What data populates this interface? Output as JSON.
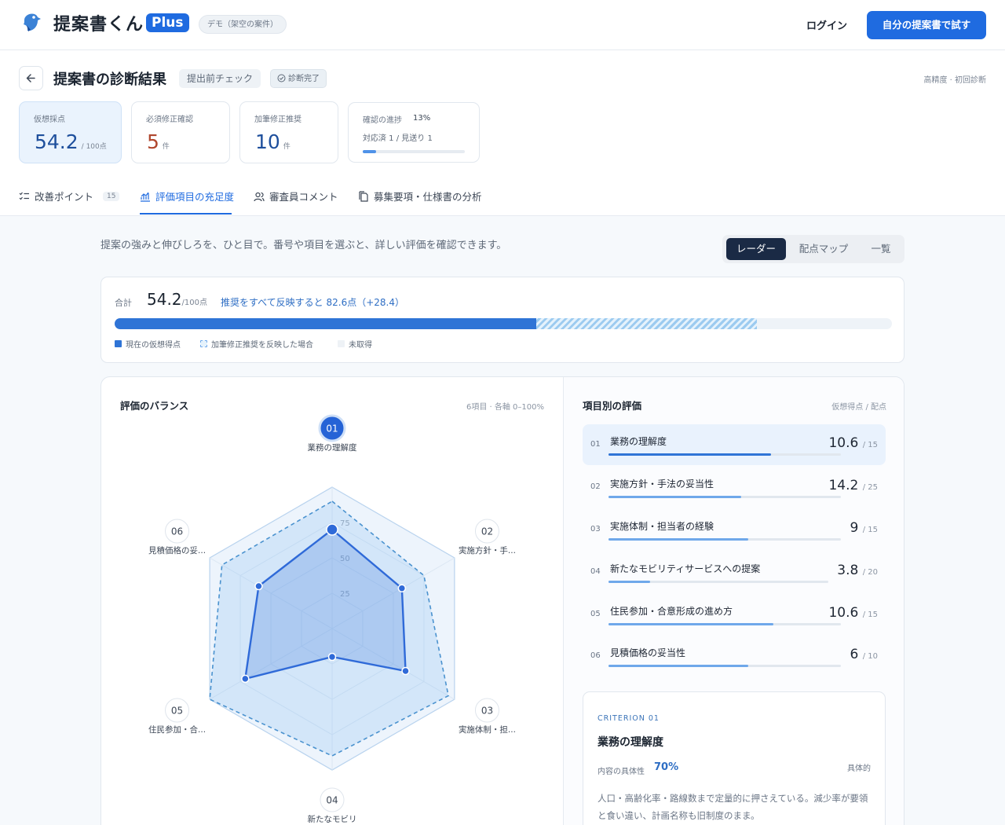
{
  "header": {
    "app_name": "提案書くん",
    "plus": "Plus",
    "demo": "デモ（架空の案件）",
    "login": "ログイン",
    "try_button": "自分の提案書で試す"
  },
  "page": {
    "title": "提案書の診断結果",
    "chip_check": "提出前チェック",
    "chip_done": "診断完了",
    "precision": "高精度 · 初回診断"
  },
  "stats": {
    "score": {
      "label": "仮想採点",
      "value": "54.2",
      "unit": "/ 100点"
    },
    "must_fix": {
      "label": "必須修正確認",
      "value": "5",
      "unit": "件"
    },
    "suggest": {
      "label": "加筆修正推奨",
      "value": "10",
      "unit": "件"
    },
    "progress": {
      "label": "確認の進捗",
      "pct": "13%",
      "detail": "対応済 1 / 見送り 1",
      "fill": 0.13
    }
  },
  "tabs": [
    {
      "label": "改善ポイント",
      "count": "15"
    },
    {
      "label": "評価項目の充足度"
    },
    {
      "label": "審査員コメント"
    },
    {
      "label": "募集要項・仕様書の分析"
    }
  ],
  "intro": "提案の強みと伸びしろを、ひと目で。番号や項目を選ぶと、詳しい評価を確認できます。",
  "view": {
    "radar": "レーダー",
    "map": "配点マップ",
    "list": "一覧"
  },
  "summary": {
    "label": "合計",
    "value": "54.2",
    "unit": "/100点",
    "hint": "推奨をすべて反映すると 82.6点（+28.4）",
    "current": 54.2,
    "potential": 82.6,
    "legend": {
      "current": "現在の仮想得点",
      "potential": "加筆修正推奨を反映した場合",
      "missing": "未取得"
    }
  },
  "colors": {
    "accent": "#1f6be0",
    "current": "#2f74d6",
    "potential": "#9ccbf0"
  },
  "radar": {
    "title": "評価のバランス",
    "meta": "6項目 · 各軸 0–100%",
    "ticks": [
      "25",
      "50",
      "75"
    ],
    "axes": [
      {
        "num": "01",
        "label": "業務の理解度",
        "current": 70,
        "potential": 90
      },
      {
        "num": "02",
        "label": "実施方針・手...",
        "current": 57,
        "potential": 75
      },
      {
        "num": "03",
        "label": "実施体制・担...",
        "current": 60,
        "potential": 95
      },
      {
        "num": "04",
        "label": "新たなモビリ",
        "current": 20,
        "potential": 90
      },
      {
        "num": "05",
        "label": "住民参加・合...",
        "current": 71,
        "potential": 100
      },
      {
        "num": "06",
        "label": "見積価格の妥...",
        "current": 60,
        "potential": 90
      }
    ]
  },
  "criteria": {
    "title": "項目別の評価",
    "meta": "仮想得点 / 配点",
    "items": [
      {
        "num": "01",
        "name": "業務の理解度",
        "score": "10.6",
        "max": "/ 15",
        "ratio": 0.7
      },
      {
        "num": "02",
        "name": "実施方針・手法の妥当性",
        "score": "14.2",
        "max": "/ 25",
        "ratio": 0.57
      },
      {
        "num": "03",
        "name": "実施体制・担当者の経験",
        "score": "9",
        "max": "/ 15",
        "ratio": 0.6
      },
      {
        "num": "04",
        "name": "新たなモビリティサービスへの提案",
        "score": "3.8",
        "max": "/ 20",
        "ratio": 0.19
      },
      {
        "num": "05",
        "name": "住民参加・合意形成の進め方",
        "score": "10.6",
        "max": "/ 15",
        "ratio": 0.71
      },
      {
        "num": "06",
        "name": "見積価格の妥当性",
        "score": "6",
        "max": "/ 10",
        "ratio": 0.6
      }
    ]
  },
  "detail": {
    "kicker": "CRITERION 01",
    "title": "業務の理解度",
    "label": "内容の具体性",
    "pct": "70%",
    "tag": "具体的",
    "body": "人口・高齢化率・路線数まで定量的に押さえている。減少率が要領と食い違い、計画名称も旧制度のまま。"
  }
}
